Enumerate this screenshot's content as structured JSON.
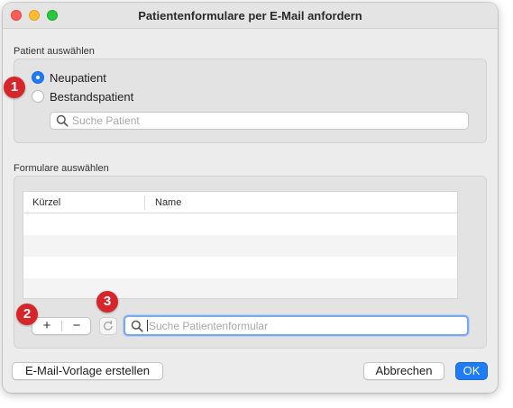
{
  "window": {
    "title": "Patientenformulare per E-Mail anfordern"
  },
  "patient_section": {
    "label": "Patient auswählen",
    "options": [
      {
        "label": "Neupatient",
        "selected": true
      },
      {
        "label": "Bestandspatient",
        "selected": false
      }
    ],
    "search": {
      "placeholder": "Suche Patient",
      "value": ""
    }
  },
  "forms_section": {
    "label": "Formulare auswählen",
    "columns": [
      "Kürzel",
      "Name"
    ],
    "rows": [],
    "add_label": "+",
    "remove_label": "−",
    "search": {
      "placeholder": "Suche Patientenformular",
      "value": ""
    }
  },
  "footer": {
    "template_button": "E-Mail-Vorlage erstellen",
    "cancel_button": "Abbrechen",
    "ok_button": "OK"
  },
  "annotations": {
    "badge_1": "1",
    "badge_2": "2",
    "badge_3": "3"
  },
  "colors": {
    "accent": "#1f7cf5",
    "badge": "#d7262b"
  },
  "icons": {
    "search": "search-icon",
    "refresh": "refresh-icon"
  }
}
